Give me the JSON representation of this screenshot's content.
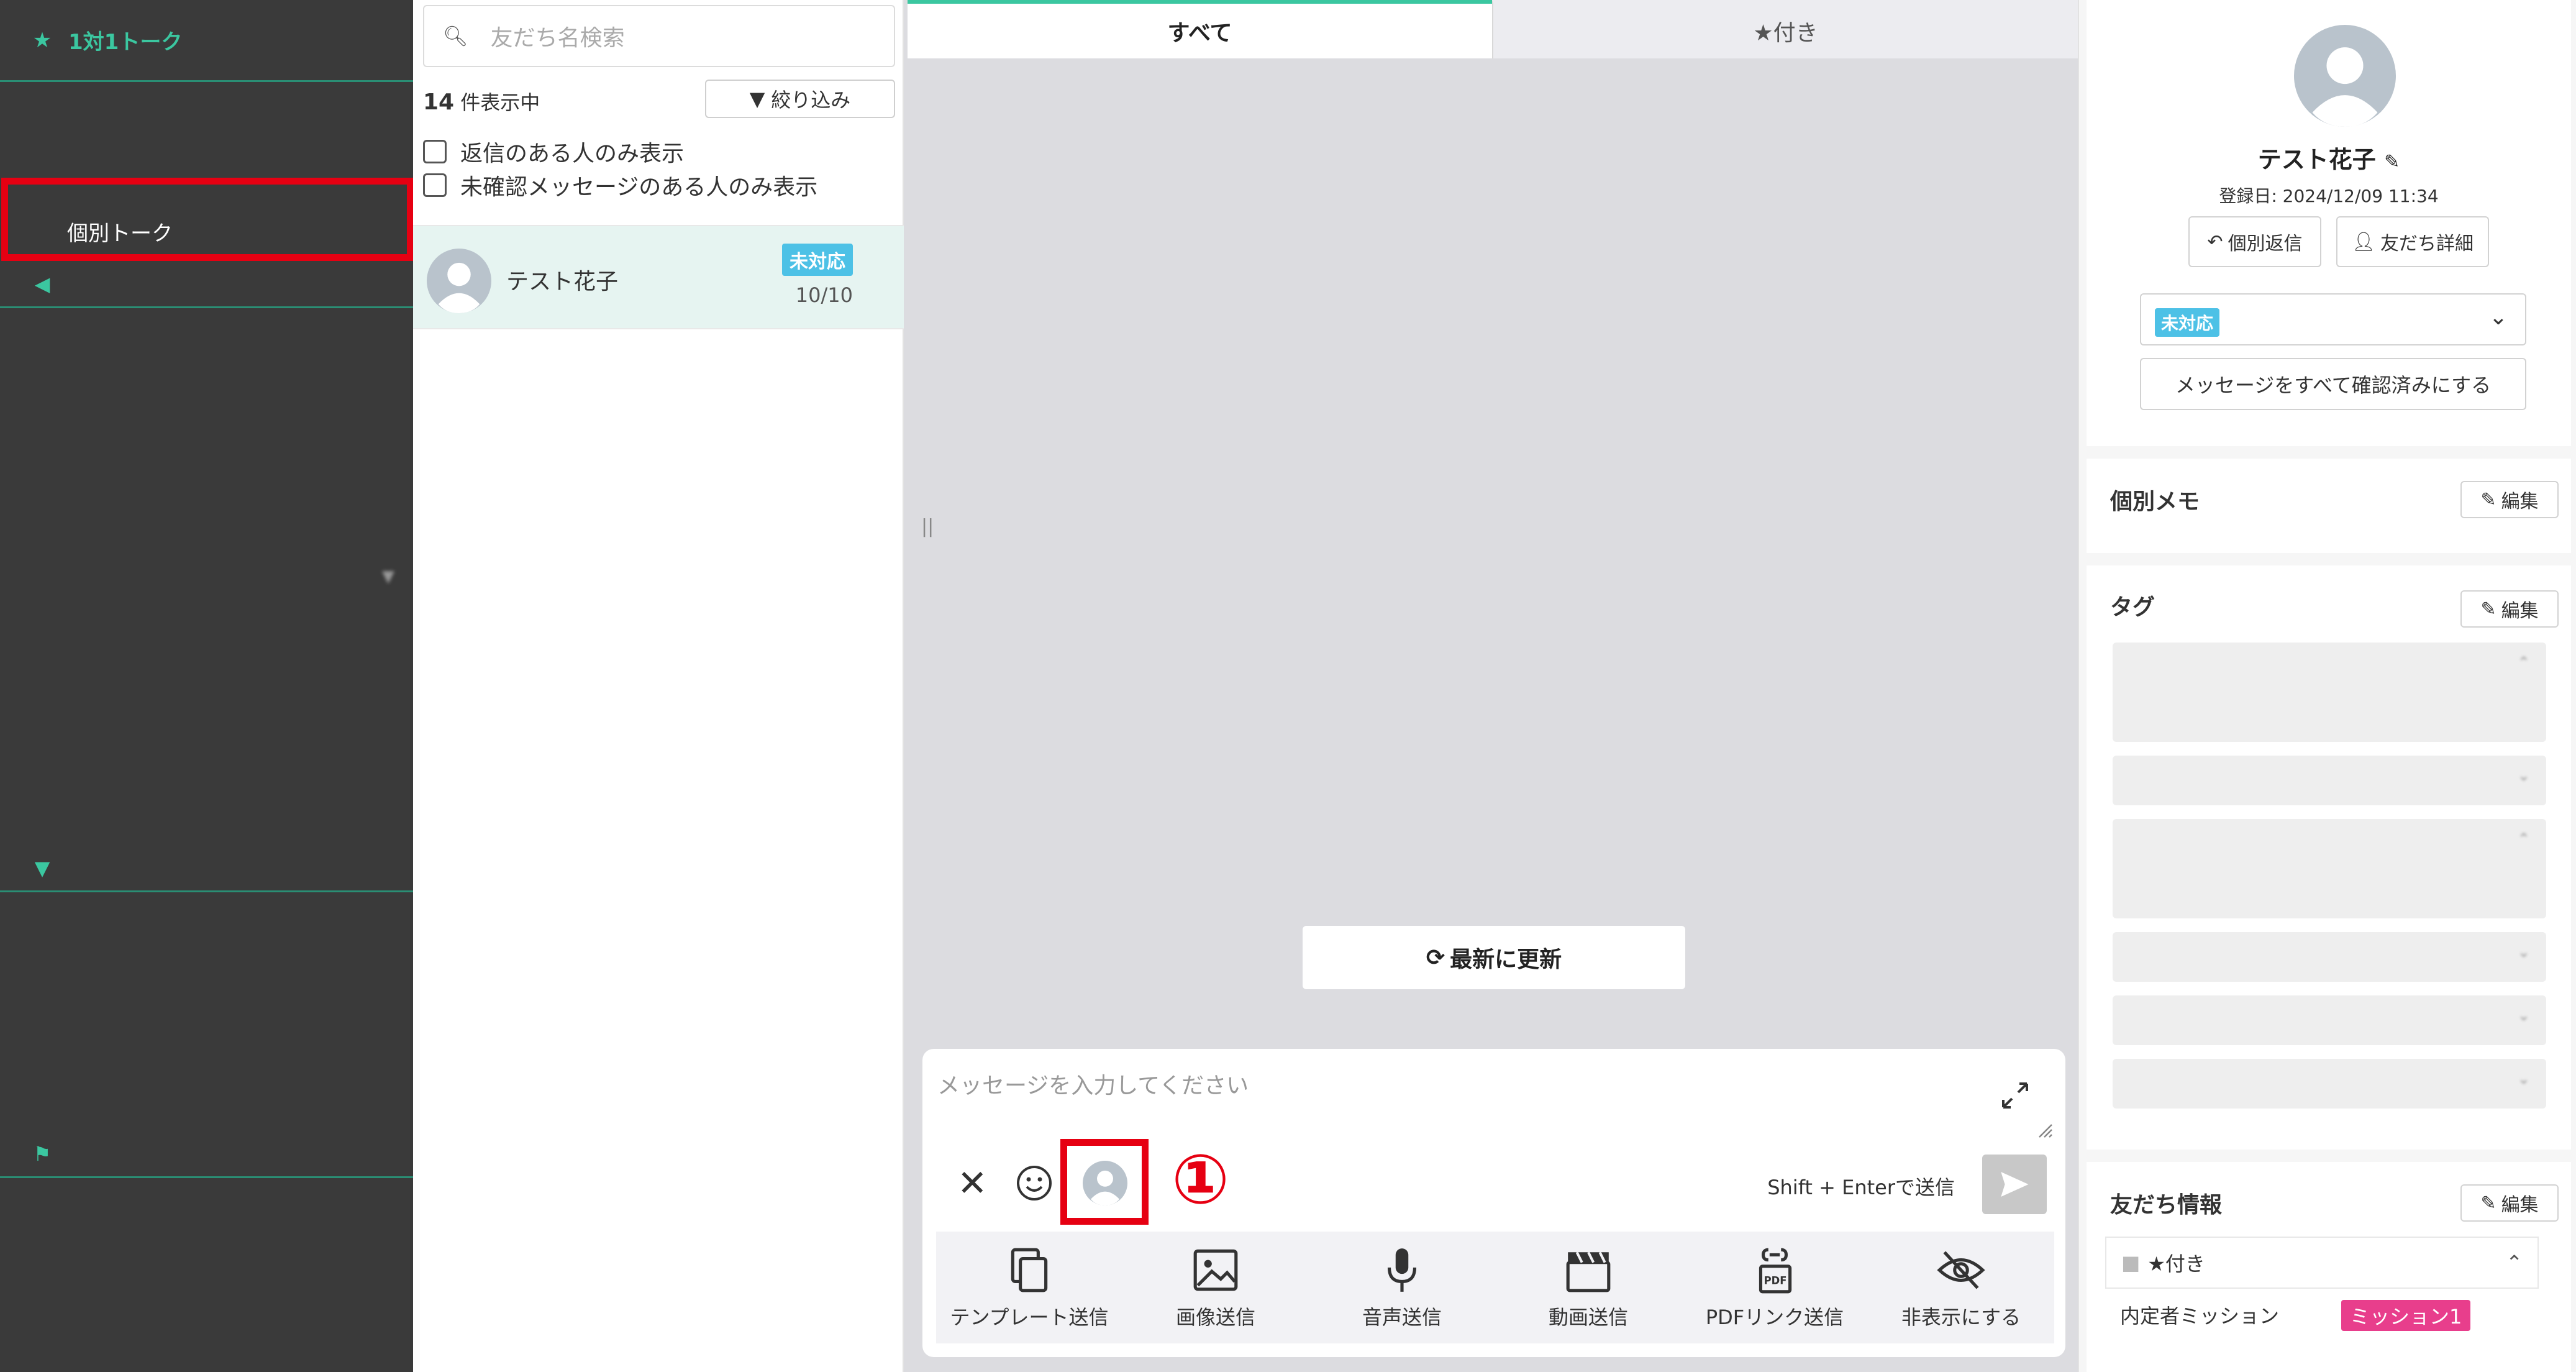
{
  "sidebar": {
    "header": "1対1トーク",
    "items_group1": [
      "",
      "",
      "個別トーク"
    ],
    "section_message": "",
    "items_message": [
      "",
      "",
      "",
      "",
      "",
      "",
      "",
      "",
      ""
    ],
    "section_friends": "",
    "items_friends": [
      "",
      "",
      "",
      ""
    ],
    "section_analysis": "",
    "items_analysis": [
      "",
      "",
      ""
    ]
  },
  "friend_list": {
    "search_placeholder": "友だち名検索",
    "count_number": "14",
    "count_suffix": "件表示中",
    "filter_label": "絞り込み",
    "check_replied": "返信のある人のみ表示",
    "check_unread": "未確認メッセージのある人のみ表示",
    "friends": [
      {
        "name": "テスト花子",
        "badge": "未対応",
        "date": "10/10"
      }
    ]
  },
  "chat": {
    "tab_all": "すべて",
    "tab_starred": "★付き",
    "refresh_label": "最新に更新",
    "input_placeholder": "メッセージを入力してください",
    "send_hint": "Shift + Enterで送信",
    "annotation": "①",
    "actions": [
      "テンプレート送信",
      "画像送信",
      "音声送信",
      "動画送信",
      "PDFリンク送信",
      "非表示にする"
    ]
  },
  "profile": {
    "name": "テスト花子",
    "registered": "登録日: 2024/12/09 11:34",
    "reply_button": "個別返信",
    "detail_button": "友だち詳細",
    "status": "未対応",
    "confirm_all": "メッセージをすべて確認済みにする",
    "memo_title": "個別メモ",
    "edit_label": "編集",
    "tag_title": "タグ",
    "tags": [
      "",
      "",
      "",
      "",
      "",
      "",
      ""
    ],
    "tag_details": [
      "",
      ""
    ],
    "friend_info_title": "友だち情報",
    "friend_info_group": "★付き",
    "friend_info_field": "内定者ミッション",
    "friend_info_value": "ミッション1"
  },
  "colors": {
    "accent": "#3bc7a0",
    "sidebar_bg": "#3a3a3a",
    "badge": "#4dc1e6",
    "annotation_red": "#e60012",
    "mission_pink": "#e83e8c"
  }
}
